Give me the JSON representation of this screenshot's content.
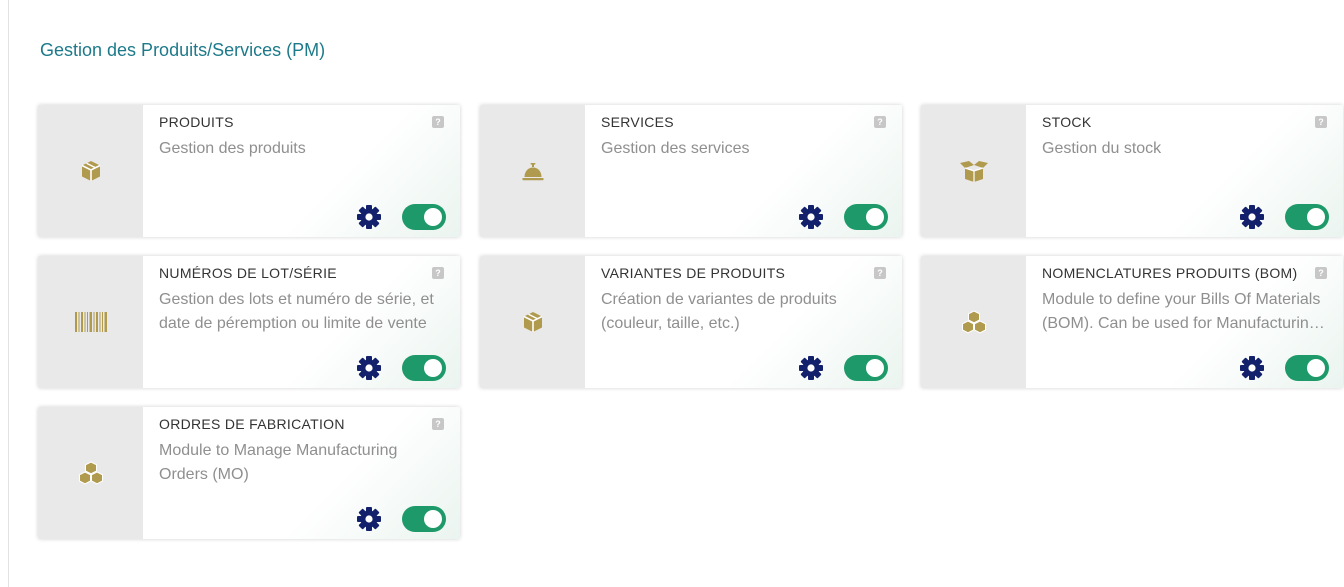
{
  "section": {
    "title": "Gestion des Produits/Services (PM)"
  },
  "colors": {
    "accent": "#1d7a8a",
    "toggle_on": "#1e9a6a",
    "icon_gold": "#b09a4e",
    "gear": "#13206b"
  },
  "help_glyph": "?",
  "modules": [
    {
      "name": "PRODUITS",
      "description": "Gestion des produits",
      "icon": "cube-icon",
      "enabled": true
    },
    {
      "name": "SERVICES",
      "description": "Gestion des services",
      "icon": "bell-icon",
      "enabled": true
    },
    {
      "name": "STOCK",
      "description": "Gestion du stock",
      "icon": "open-box-icon",
      "enabled": true
    },
    {
      "name": "NUMÉROS DE LOT/SÉRIE",
      "description": "Gestion des lots et numéro de série, et date de péremption ou limite de vente",
      "icon": "barcode-icon",
      "enabled": true
    },
    {
      "name": "VARIANTES DE PRODUITS",
      "description": "Création de variantes de produits (couleur, taille, etc.)",
      "icon": "cube-icon",
      "enabled": true
    },
    {
      "name": "NOMENCLATURES PRODUITS (BOM)",
      "description": "Module to define your Bills Of Materials (BOM). Can be used for Manufacturing Resource Planning",
      "icon": "cubes-icon",
      "enabled": true
    },
    {
      "name": "ORDRES DE FABRICATION",
      "description": "Module to Manage Manufacturing Orders (MO)",
      "icon": "cubes-icon",
      "enabled": true
    }
  ]
}
